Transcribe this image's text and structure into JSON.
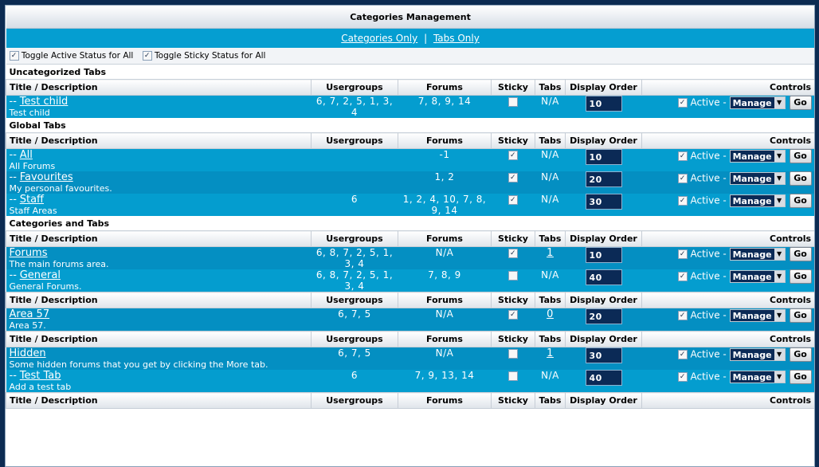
{
  "page": {
    "title": "Categories Management",
    "link_categories": "Categories Only",
    "link_separator": "|",
    "link_tabs": "Tabs Only",
    "toggle_active": "Toggle Active Status for All",
    "toggle_sticky": "Toggle Sticky Status for All"
  },
  "columns": {
    "title": "Title / Description",
    "usergroups": "Usergroups",
    "forums": "Forums",
    "sticky": "Sticky",
    "tabs": "Tabs",
    "order": "Display Order",
    "controls": "Controls"
  },
  "labels": {
    "active": "Active -",
    "manage": "Manage",
    "go": "Go",
    "dash": "--",
    "check": "✓"
  },
  "sections": [
    {
      "title": "Uncategorized Tabs"
    },
    {
      "title": "Global Tabs"
    },
    {
      "title": "Categories and Tabs"
    }
  ],
  "rows": [
    {
      "name": "Test child",
      "desc": "Test child",
      "usergroups": "6, 7, 2, 5, 1, 3, 4",
      "forums": "7, 8, 9, 14",
      "sticky": false,
      "tabs": "N/A",
      "order": "10",
      "active": true,
      "child": true
    },
    {
      "name": "All",
      "desc": "All Forums",
      "usergroups": "",
      "forums": "-1",
      "sticky": true,
      "tabs": "N/A",
      "order": "10",
      "active": true,
      "child": true
    },
    {
      "name": "Favourites",
      "desc": "My personal favourites.",
      "usergroups": "",
      "forums": "1, 2",
      "sticky": true,
      "tabs": "N/A",
      "order": "20",
      "active": true,
      "child": true
    },
    {
      "name": "Staff",
      "desc": "Staff Areas",
      "usergroups": "6",
      "forums": "1, 2, 4, 10, 7, 8, 9, 14",
      "sticky": true,
      "tabs": "N/A",
      "order": "30",
      "active": true,
      "child": true
    },
    {
      "name": "Forums",
      "desc": "The main forums area.",
      "usergroups": "6, 8, 7, 2, 5, 1, 3, 4",
      "forums": "N/A",
      "sticky": true,
      "tabs": "1",
      "order": "10",
      "active": true,
      "child": false
    },
    {
      "name": "General",
      "desc": "General Forums.",
      "usergroups": "6, 8, 7, 2, 5, 1, 3, 4",
      "forums": "7, 8, 9",
      "sticky": false,
      "tabs": "N/A",
      "order": "40",
      "active": true,
      "child": true
    },
    {
      "name": "Area 57",
      "desc": "Area 57.",
      "usergroups": "6, 7, 5",
      "forums": "N/A",
      "sticky": true,
      "tabs": "0",
      "order": "20",
      "active": true,
      "child": false
    },
    {
      "name": "Hidden",
      "desc": "Some hidden forums that you get by clicking the More tab.",
      "usergroups": "6, 7, 5",
      "forums": "N/A",
      "sticky": false,
      "tabs": "1",
      "order": "30",
      "active": true,
      "child": false
    },
    {
      "name": "Test Tab",
      "desc": "Add a test tab",
      "usergroups": "6",
      "forums": "7, 9, 13, 14",
      "sticky": false,
      "tabs": "N/A",
      "order": "40",
      "active": true,
      "child": true
    }
  ]
}
